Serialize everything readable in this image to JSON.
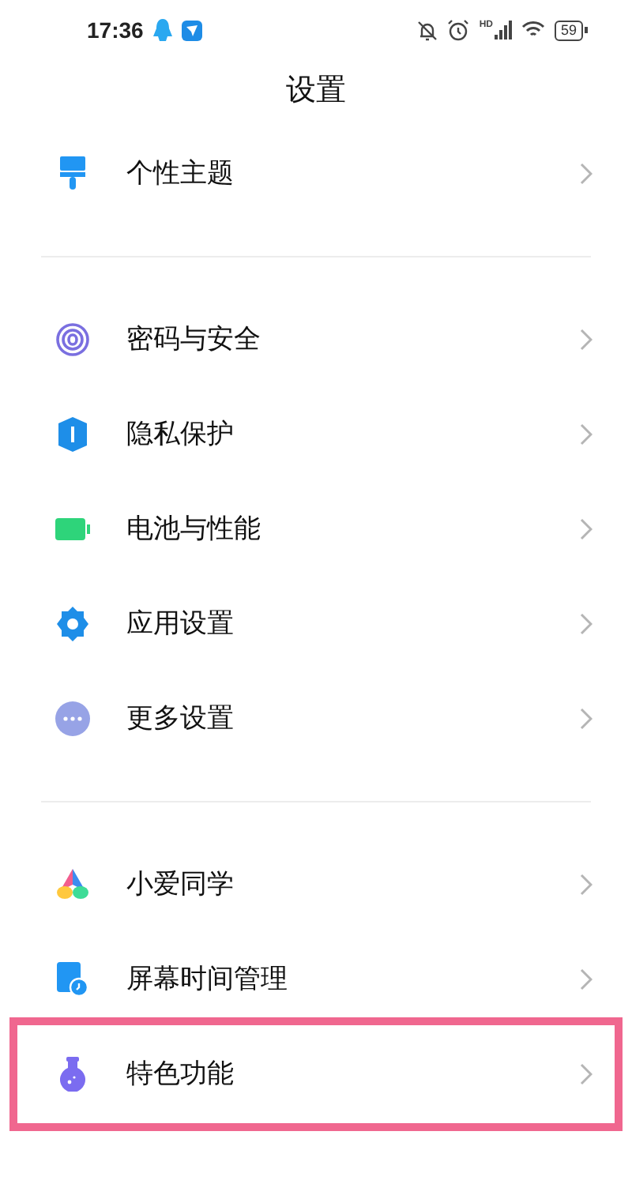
{
  "status_bar": {
    "time": "17:36",
    "network_label": "HD",
    "battery": "59"
  },
  "title": "设置",
  "groups": [
    {
      "items": [
        {
          "kind": "theme",
          "label": "个性主题",
          "highlighted": false
        }
      ]
    },
    {
      "items": [
        {
          "kind": "password",
          "label": "密码与安全",
          "highlighted": false
        },
        {
          "kind": "privacy",
          "label": "隐私保护",
          "highlighted": false
        },
        {
          "kind": "battery",
          "label": "电池与性能",
          "highlighted": false
        },
        {
          "kind": "apps",
          "label": "应用设置",
          "highlighted": false
        },
        {
          "kind": "more",
          "label": "更多设置",
          "highlighted": false
        }
      ]
    },
    {
      "items": [
        {
          "kind": "assistant",
          "label": "小爱同学",
          "highlighted": false
        },
        {
          "kind": "screentime",
          "label": "屏幕时间管理",
          "highlighted": false
        },
        {
          "kind": "features",
          "label": "特色功能",
          "highlighted": true
        }
      ]
    }
  ]
}
